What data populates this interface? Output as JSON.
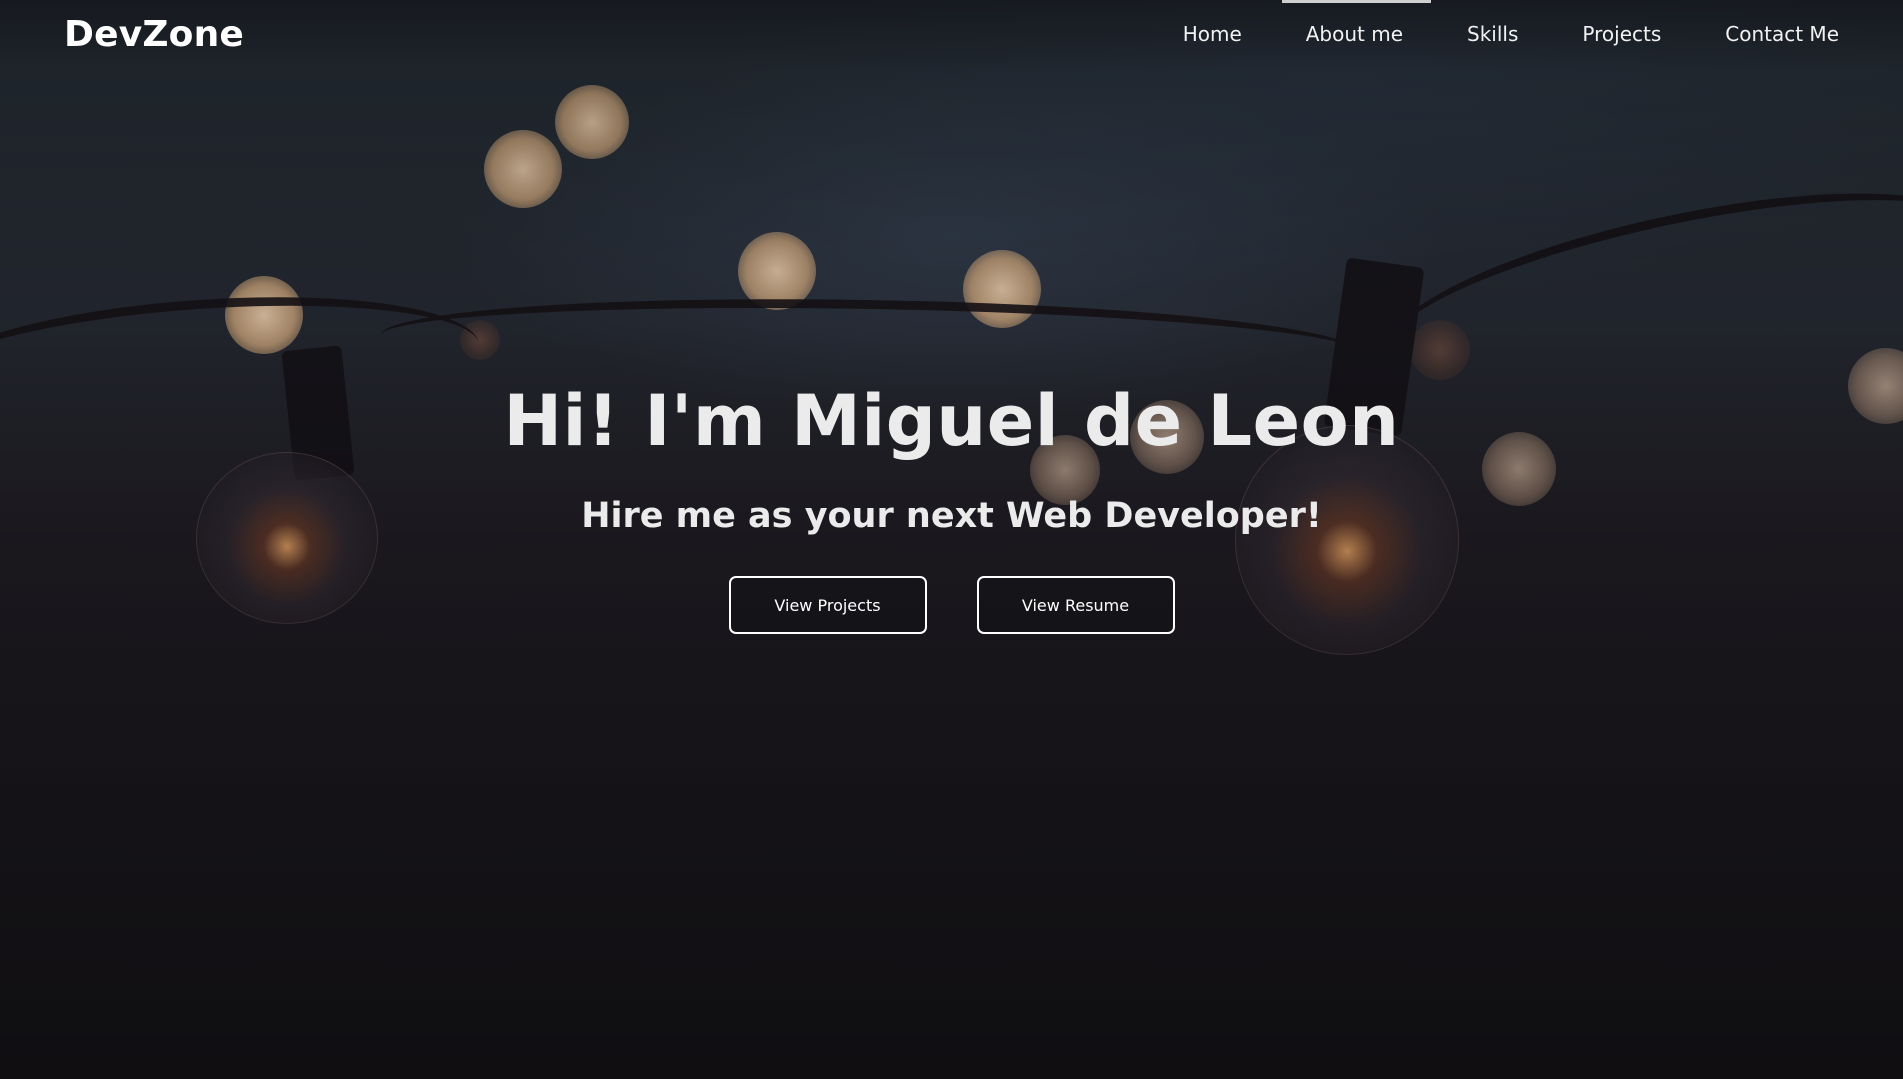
{
  "brand": {
    "name": "DevZone"
  },
  "nav": {
    "items": [
      {
        "label": "Home"
      },
      {
        "label": "About me"
      },
      {
        "label": "Skills"
      },
      {
        "label": "Projects"
      },
      {
        "label": "Contact Me"
      }
    ]
  },
  "hero": {
    "headline": "Hi! I'm Miguel de Leon",
    "subheadline": "Hire me as your next Web Developer!",
    "buttons": {
      "projects": "View Projects",
      "resume": "View Resume"
    }
  },
  "colors": {
    "text": "#ebebeb",
    "button_border": "#ffffff",
    "background": "#1c1a1f"
  }
}
